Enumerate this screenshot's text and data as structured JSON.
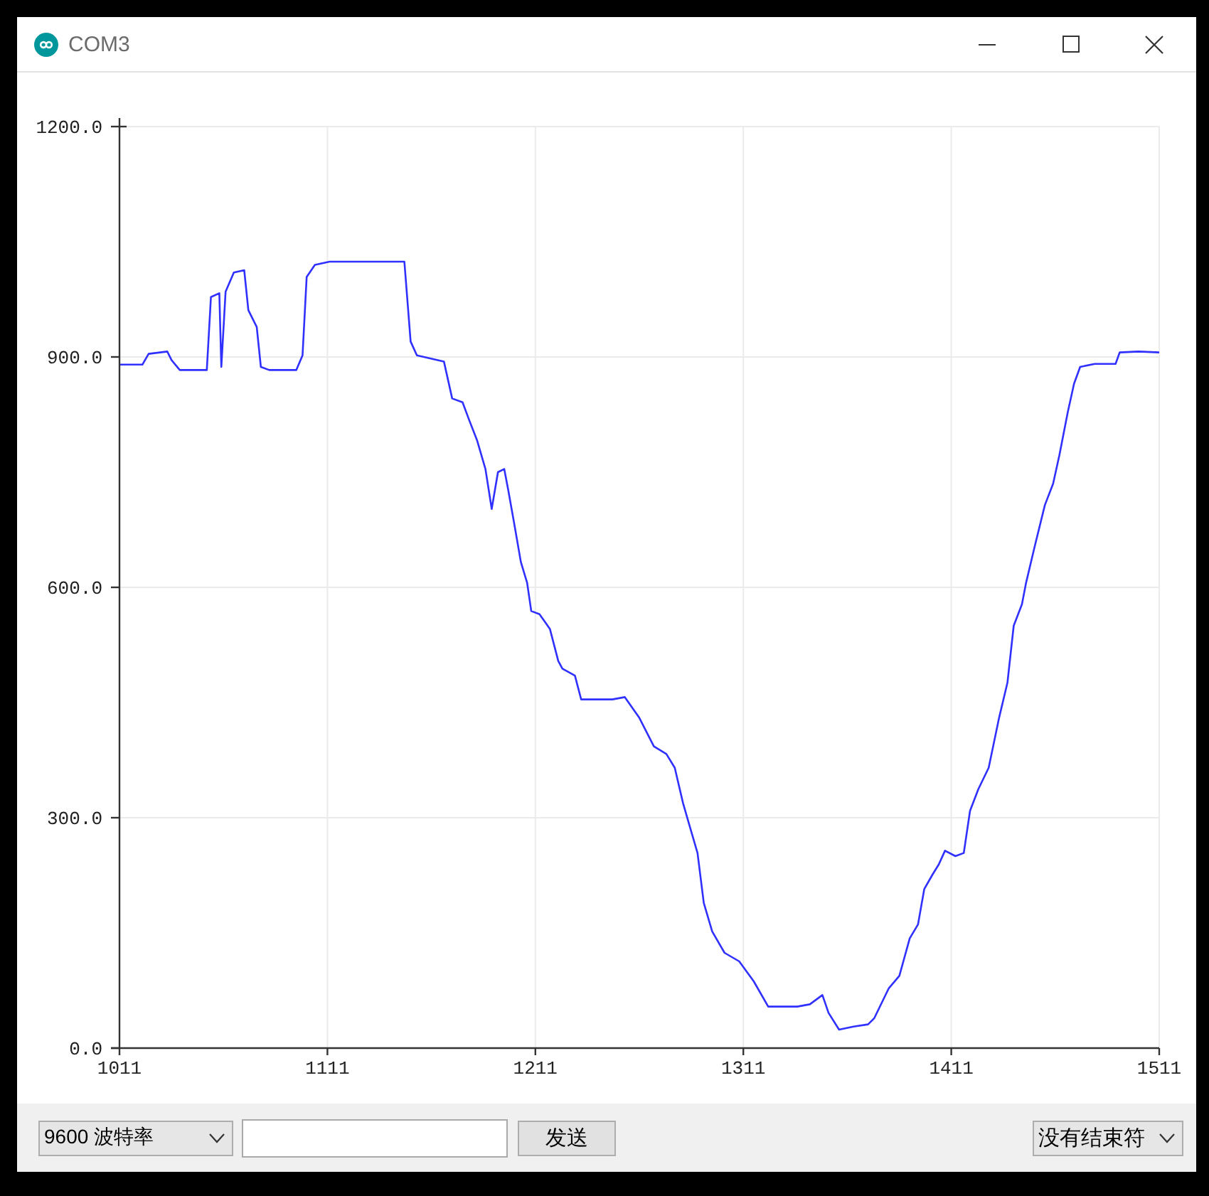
{
  "window": {
    "title": "COM3"
  },
  "plot": {
    "chart_data": {
      "type": "line",
      "grid": true,
      "x": [
        1011,
        1022,
        1025,
        1034,
        1036,
        1040,
        1053,
        1055,
        1059,
        1060,
        1062,
        1066,
        1071,
        1073,
        1077,
        1079,
        1083,
        1096,
        1099,
        1101,
        1105,
        1112,
        1148,
        1151,
        1154,
        1167,
        1171,
        1176,
        1179,
        1183,
        1187,
        1190,
        1193,
        1196,
        1198,
        1201,
        1204,
        1207,
        1209,
        1213,
        1218,
        1222,
        1224,
        1230,
        1233,
        1248,
        1254,
        1261,
        1268,
        1274,
        1278,
        1282,
        1285,
        1289,
        1292,
        1296,
        1302,
        1309,
        1316,
        1323,
        1337,
        1343,
        1349,
        1352,
        1357,
        1364,
        1371,
        1374,
        1381,
        1386,
        1391,
        1395,
        1398,
        1402,
        1405,
        1408,
        1413,
        1417,
        1420,
        1424,
        1429,
        1434,
        1438,
        1441,
        1445,
        1447,
        1451,
        1456,
        1460,
        1463,
        1467,
        1470,
        1473,
        1480,
        1490,
        1492,
        1501,
        1511
      ],
      "series": [
        {
          "color": "#3030ff",
          "values": [
            890,
            890,
            904,
            907,
            896,
            883,
            883,
            978,
            983,
            887,
            985,
            1010,
            1013,
            961,
            939,
            887,
            883,
            883,
            902,
            1004,
            1020,
            1024,
            1024,
            920,
            902,
            894,
            846,
            841,
            819,
            791,
            754,
            702,
            750,
            754,
            726,
            680,
            633,
            606,
            569,
            565,
            546,
            504,
            494,
            485,
            454,
            454,
            457,
            430,
            393,
            383,
            365,
            319,
            291,
            254,
            189,
            152,
            124,
            113,
            87,
            54,
            54,
            57,
            69,
            46,
            24,
            28,
            31,
            39,
            78,
            94,
            143,
            161,
            207,
            226,
            239,
            257,
            250,
            254,
            309,
            337,
            365,
            430,
            476,
            550,
            578,
            606,
            652,
            707,
            735,
            772,
            828,
            865,
            887,
            891,
            891,
            906,
            907,
            906
          ]
        }
      ],
      "xlim": [
        1011,
        1511
      ],
      "ylim": [
        0,
        1200
      ],
      "xticks": [
        1011,
        1111,
        1211,
        1311,
        1411,
        1511
      ],
      "yticks": [
        {
          "value": 0,
          "label": "0.0"
        },
        {
          "value": 300,
          "label": "300.0"
        },
        {
          "value": 600,
          "label": "600.0"
        },
        {
          "value": 900,
          "label": "900.0"
        },
        {
          "value": 1200,
          "label": "1200.0"
        }
      ]
    }
  },
  "toolbar": {
    "baud_rate": "9600 波特率",
    "send_button": "发送",
    "line_ending": "没有结束符"
  }
}
